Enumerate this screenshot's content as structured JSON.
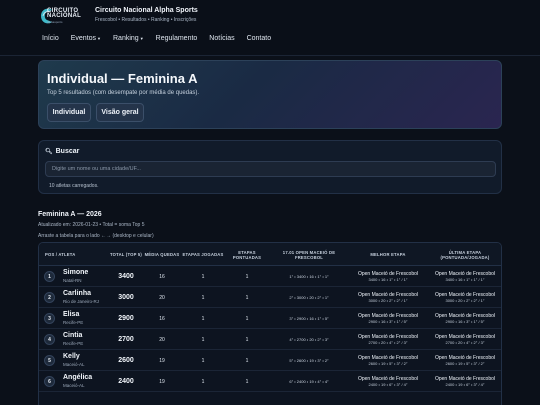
{
  "brand": {
    "logo_line1": "CIRCUITO",
    "logo_line2": "NACIONAL",
    "logo_sub": "alphasports",
    "title": "Circuito Nacional Alpha Sports",
    "subtitle": "Frescobol • Resultados • Ranking • Inscrições"
  },
  "nav": {
    "items": [
      {
        "label": "Início",
        "dropdown": false
      },
      {
        "label": "Eventos",
        "dropdown": true
      },
      {
        "label": "Ranking",
        "dropdown": true
      },
      {
        "label": "Regulamento",
        "dropdown": false
      },
      {
        "label": "Notícias",
        "dropdown": false
      },
      {
        "label": "Contato",
        "dropdown": false
      }
    ]
  },
  "hero": {
    "title": "Individual — Feminina A",
    "subtitle": "Top 5 resultados (com desempate por média de quedas).",
    "buttons": [
      "Individual",
      "Visão geral"
    ]
  },
  "search": {
    "label": "Buscar",
    "placeholder": "Digite um nome ou uma cidade/UF...",
    "value": "",
    "count_text": "10 atletas carregados."
  },
  "ranking": {
    "title": "Feminina A — 2026",
    "updated": "Atualizado em: 2026-01-23 • Total = soma Top 5",
    "hint": "Arraste a tabela para o lado ←→ (desktop e celular)",
    "columns": [
      "POS / ATLETA",
      "TOTAL (TOP 5)",
      "MÉDIA QUEDAS",
      "ETAPAS JOGADAS",
      "ETAPAS PONTUADAS",
      "17.01 OPEN MACEIÓ DE FRESCOBOL",
      "MELHOR ETAPA",
      "ÚLTIMA ETAPA (PONTUADA/JOGADA)"
    ],
    "rows": [
      {
        "pos": "1",
        "name": "Simone",
        "city": "Natal-RN",
        "total": "3400",
        "media": "16",
        "jogadas": "1",
        "pontuadas": "1",
        "etapa": "1° • 3400 • 16 • 1° • 1°",
        "melhor_nome": "Open Maceió de Frescobol",
        "melhor_det": "3400 • 16 • 1° • 1° / 1°",
        "ultima_nome": "Open Maceió de Frescobol",
        "ultima_det": "3400 • 16 • 1° • 1° / 1°"
      },
      {
        "pos": "2",
        "name": "Carlinha",
        "city": "Rio de Janeiro-RJ",
        "total": "3000",
        "media": "20",
        "jogadas": "1",
        "pontuadas": "1",
        "etapa": "2° • 3000 • 20 • 2° • 1°",
        "melhor_nome": "Open Maceió de Frescobol",
        "melhor_det": "3000 • 20 • 2° • 2° / 1°",
        "ultima_nome": "Open Maceió de Frescobol",
        "ultima_det": "3000 • 20 • 2° • 2° / 1°"
      },
      {
        "pos": "3",
        "name": "Elisa",
        "city": "Recife-PE",
        "total": "2900",
        "media": "16",
        "jogadas": "1",
        "pontuadas": "1",
        "etapa": "3° • 2900 • 16 • 1° • 5°",
        "melhor_nome": "Open Maceió de Frescobol",
        "melhor_det": "2900 • 16 • 3° • 1° / 5°",
        "ultima_nome": "Open Maceió de Frescobol",
        "ultima_det": "2900 • 16 • 3° • 1° / 5°"
      },
      {
        "pos": "4",
        "name": "Cintia",
        "city": "Recife-PE",
        "total": "2700",
        "media": "20",
        "jogadas": "1",
        "pontuadas": "1",
        "etapa": "4° • 2700 • 20 • 2° • 3°",
        "melhor_nome": "Open Maceió de Frescobol",
        "melhor_det": "2700 • 20 • 4° • 2° / 3°",
        "ultima_nome": "Open Maceió de Frescobol",
        "ultima_det": "2700 • 20 • 4° • 2° / 3°"
      },
      {
        "pos": "5",
        "name": "Kelly",
        "city": "Maceió-AL",
        "total": "2600",
        "media": "19",
        "jogadas": "1",
        "pontuadas": "1",
        "etapa": "5° • 2600 • 19 • 3° • 2°",
        "melhor_nome": "Open Maceió de Frescobol",
        "melhor_det": "2600 • 19 • 5° • 3° / 2°",
        "ultima_nome": "Open Maceió de Frescobol",
        "ultima_det": "2600 • 19 • 5° • 3° / 2°"
      },
      {
        "pos": "6",
        "name": "Angélica",
        "city": "Maceió-AL",
        "total": "2400",
        "media": "19",
        "jogadas": "1",
        "pontuadas": "1",
        "etapa": "6° • 2400 • 19 • 4° • 4°",
        "melhor_nome": "Open Maceió de Frescobol",
        "melhor_det": "2400 • 19 • 6° • 3° / 4°",
        "ultima_nome": "Open Maceió de Frescobol",
        "ultima_det": "2400 • 19 • 6° • 3° / 4°"
      }
    ]
  }
}
